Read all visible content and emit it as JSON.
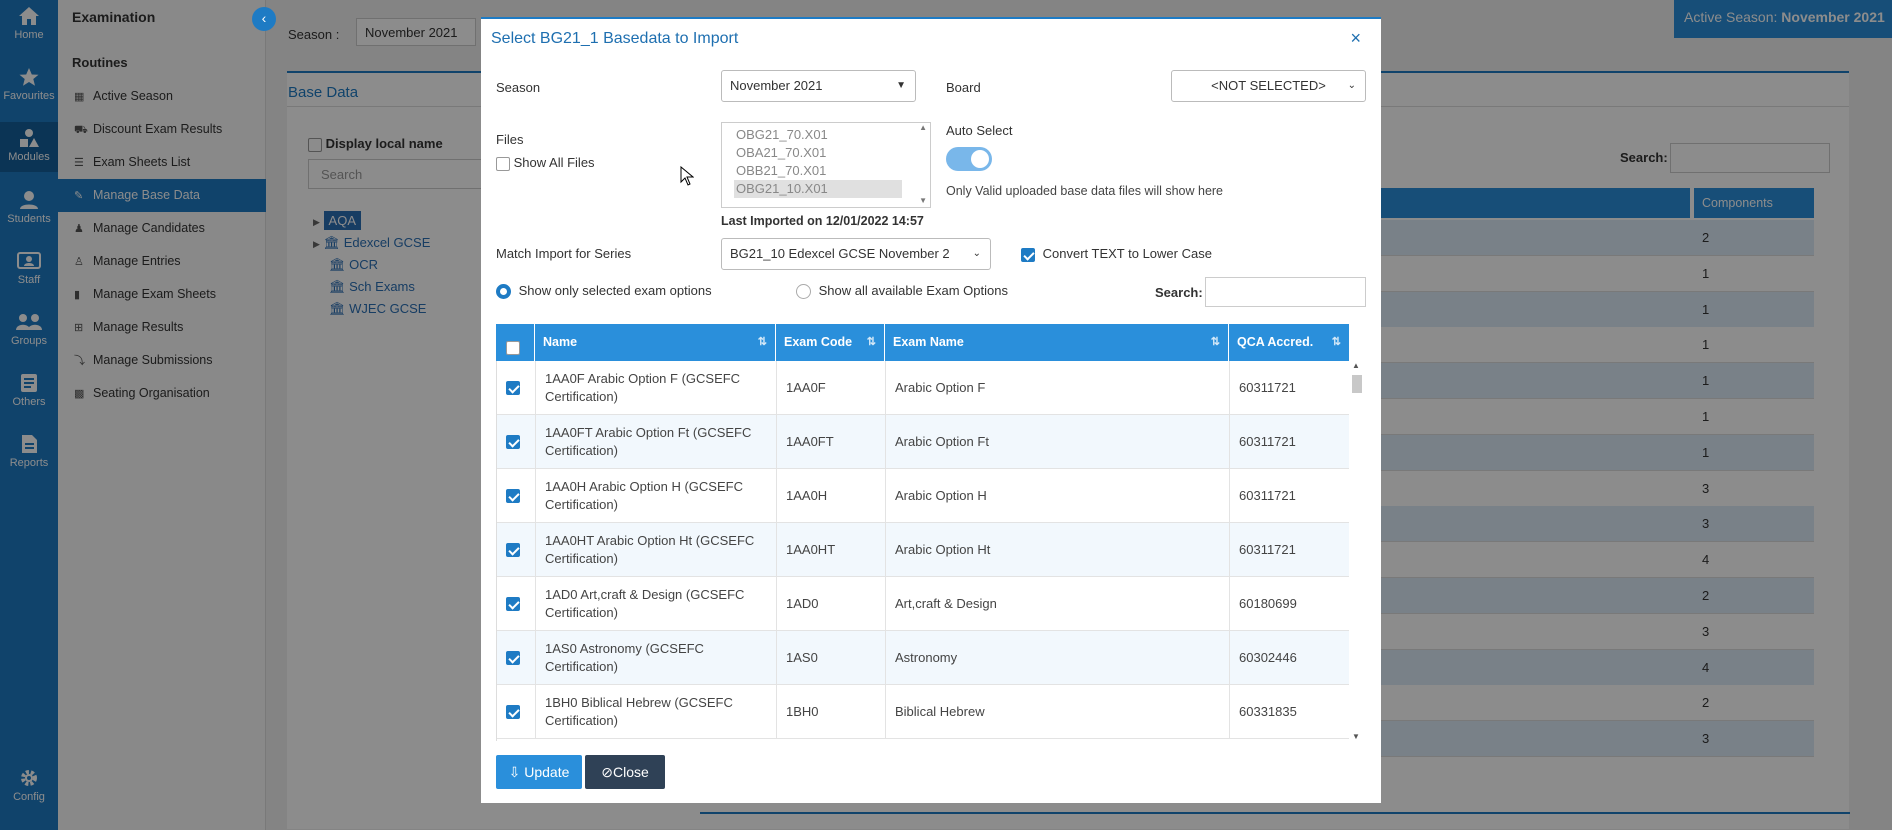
{
  "leftnav": {
    "items": [
      {
        "label": "Home",
        "icon": "home-icon"
      },
      {
        "label": "Favourites",
        "icon": "star-icon"
      },
      {
        "label": "Modules",
        "icon": "modules-icon"
      },
      {
        "label": "Students",
        "icon": "user-icon"
      },
      {
        "label": "Staff",
        "icon": "staff-icon"
      },
      {
        "label": "Groups",
        "icon": "groups-icon"
      },
      {
        "label": "Others",
        "icon": "others-icon"
      },
      {
        "label": "Reports",
        "icon": "report-icon"
      },
      {
        "label": "Config",
        "icon": "gear-icon"
      }
    ]
  },
  "sidebar": {
    "title": "Examination",
    "section": "Routines",
    "items": [
      {
        "label": "Active Season",
        "icon": "calendar-icon"
      },
      {
        "label": "Discount Exam Results",
        "icon": "cart-icon"
      },
      {
        "label": "Exam Sheets List",
        "icon": "list-icon"
      },
      {
        "label": "Manage Base Data",
        "icon": "edit-icon"
      },
      {
        "label": "Manage Candidates",
        "icon": "candidate-icon"
      },
      {
        "label": "Manage Entries",
        "icon": "entry-icon"
      },
      {
        "label": "Manage Exam Sheets",
        "icon": "book-icon"
      },
      {
        "label": "Manage Results",
        "icon": "results-icon"
      },
      {
        "label": "Manage Submissions",
        "icon": "submission-icon"
      },
      {
        "label": "Seating Organisation",
        "icon": "grid-icon"
      }
    ]
  },
  "background": {
    "season_label": "Season :",
    "season_value": "November 2021",
    "active_season_label": "Active Season:",
    "active_season_value": "November 2021",
    "base_data_title": "Base Data",
    "display_local_name": "Display local name",
    "search_placeholder": "Search",
    "search_label": "Search:",
    "components_header": "Components",
    "tree": [
      "AQA",
      "Edexcel GCSE",
      "OCR",
      "Sch Exams",
      "WJEC GCSE"
    ],
    "components": [
      "2",
      "1",
      "1",
      "1",
      "1",
      "1",
      "1",
      "3",
      "3",
      "4",
      "2",
      "3",
      "4",
      "2",
      "3"
    ]
  },
  "modal": {
    "title": "Select BG21_1 Basedata to Import",
    "close_x": "×",
    "season_label": "Season",
    "season_value": "November 2021",
    "board_label": "Board",
    "board_value": "<NOT SELECTED>",
    "files_label": "Files",
    "show_all_files": "Show All Files",
    "files": [
      "OBG21_70.X01",
      "OBA21_70.X01",
      "OBB21_70.X01",
      "OBG21_10.X01"
    ],
    "auto_select_label": "Auto Select",
    "auto_select_on": true,
    "valid_note": "Only Valid uploaded base data files will show here",
    "last_imported": "Last Imported on 12/01/2022 14:57",
    "match_label": "Match Import for Series",
    "match_value": "BG21_10 Edexcel GCSE November 2",
    "convert_text": "Convert TEXT to Lower Case",
    "radio_selected": "Show only selected exam options",
    "radio_all": "Show all available Exam Options",
    "search_label": "Search:",
    "columns": [
      "Name",
      "Exam Code",
      "Exam Name",
      "QCA Accred."
    ],
    "rows": [
      {
        "name": "1AA0F Arabic Option F (GCSEFC Certification)",
        "code": "1AA0F",
        "exam": "Arabic Option F",
        "qca": "60311721"
      },
      {
        "name": "1AA0FT Arabic Option Ft (GCSEFC Certification)",
        "code": "1AA0FT",
        "exam": "Arabic Option Ft",
        "qca": "60311721"
      },
      {
        "name": "1AA0H Arabic Option H (GCSEFC Certification)",
        "code": "1AA0H",
        "exam": "Arabic Option H",
        "qca": "60311721"
      },
      {
        "name": "1AA0HT Arabic Option Ht (GCSEFC Certification)",
        "code": "1AA0HT",
        "exam": "Arabic Option Ht",
        "qca": "60311721"
      },
      {
        "name": "1AD0 Art,craft & Design (GCSEFC Certification)",
        "code": "1AD0",
        "exam": "Art,craft & Design",
        "qca": "60180699"
      },
      {
        "name": "1AS0 Astronomy (GCSEFC Certification)",
        "code": "1AS0",
        "exam": "Astronomy",
        "qca": "60302446"
      },
      {
        "name": "1BH0 Biblical Hebrew (GCSEFC Certification)",
        "code": "1BH0",
        "exam": "Biblical Hebrew",
        "qca": "60331835"
      }
    ],
    "update_label": "Update",
    "close_label": "Close"
  }
}
